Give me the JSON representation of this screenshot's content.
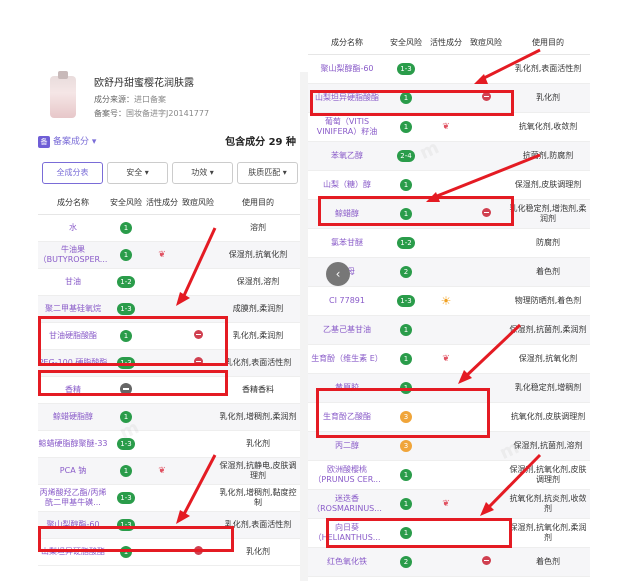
{
  "product": {
    "name": "欧舒丹甜蜜樱花润肤露",
    "source_label": "成分来源：",
    "source_value": "进口备案",
    "record_label": "备案号：",
    "record_value": "国妆备进字J20141777"
  },
  "summary": {
    "badge": "备",
    "section_label": "备案成分",
    "section_caret": "▾",
    "count_text": "包含成分 29 种"
  },
  "filters": {
    "all": "全成分表",
    "safety": "安全 ▾",
    "function": "功效 ▾",
    "skin": "肤质匹配 ▾"
  },
  "headers": {
    "name": "成分名称",
    "risk": "安全风险",
    "active": "活性成分",
    "acne": "致痘风险",
    "use": "使用目的"
  },
  "left_rows": [
    {
      "name": "水",
      "risk": "1",
      "active": "",
      "acne": false,
      "use": "溶剂"
    },
    {
      "name": "牛油果（BUTYROSPER...",
      "risk": "1",
      "active": "❦",
      "acne": false,
      "use": "保湿剂,抗氧化剂"
    },
    {
      "name": "甘油",
      "risk": "1-2",
      "active": "",
      "acne": false,
      "use": "保湿剂,溶剂"
    },
    {
      "name": "聚二甲基硅氧烷",
      "risk": "1-3",
      "active": "",
      "acne": false,
      "use": "成膜剂,柔润剂"
    },
    {
      "name": "甘油硬脂酸酯",
      "risk": "1",
      "active": "",
      "acne": true,
      "use": "乳化剂,柔润剂"
    },
    {
      "name": "PEG-100 硬脂酸酯",
      "risk": "1-3",
      "active": "",
      "acne": true,
      "use": "乳化剂,表面活性剂"
    },
    {
      "name": "香精",
      "risk": "—",
      "active": "",
      "acne": false,
      "use": "香精香料"
    },
    {
      "name": "鲸蜡硬脂醇",
      "risk": "1",
      "active": "",
      "acne": false,
      "use": "乳化剂,增稠剂,柔润剂"
    },
    {
      "name": "鲸蜡硬脂醇聚醚-33",
      "risk": "1-3",
      "active": "",
      "acne": false,
      "use": "乳化剂"
    },
    {
      "name": "PCA 钠",
      "risk": "1",
      "active": "❦",
      "acne": false,
      "use": "保湿剂,抗静电,皮肤调理剂"
    },
    {
      "name": "丙烯酸羟乙酯/丙烯酰二甲基牛磺...",
      "risk": "1-3",
      "active": "",
      "acne": false,
      "use": "乳化剂,增稠剂,黏度控制"
    },
    {
      "name": "聚山梨醇酯-60",
      "risk": "1-3",
      "active": "",
      "acne": false,
      "use": "乳化剂,表面活性剂"
    },
    {
      "name": "山梨坦异硬脂酸酯",
      "risk": "1",
      "active": "",
      "acne": true,
      "use": "乳化剂"
    }
  ],
  "right_rows": [
    {
      "name": "聚山梨醇酯-60",
      "risk": "1-3",
      "active": "",
      "acne": false,
      "use": "乳化剂,表面活性剂"
    },
    {
      "name": "山梨坦异硬脂酸酯",
      "risk": "1",
      "active": "",
      "acne": true,
      "use": "乳化剂"
    },
    {
      "name": "葡萄（VITIS VINIFERA）籽油",
      "risk": "1",
      "active": "❦",
      "acne": false,
      "use": "抗氧化剂,收敛剂"
    },
    {
      "name": "苯氧乙醇",
      "risk": "2-4",
      "active": "",
      "acne": false,
      "use": "抗菌剂,防腐剂"
    },
    {
      "name": "山梨（糖）醇",
      "risk": "1",
      "active": "",
      "acne": false,
      "use": "保湿剂,皮肤调理剂"
    },
    {
      "name": "鲸蜡醇",
      "risk": "1",
      "active": "",
      "acne": true,
      "use": "乳化稳定剂,增泡剂,柔润剂"
    },
    {
      "name": "氯苯甘醚",
      "risk": "1-2",
      "active": "",
      "acne": false,
      "use": "防腐剂"
    },
    {
      "name": "云母",
      "risk": "2",
      "active": "",
      "acne": false,
      "use": "着色剂"
    },
    {
      "name": "CI 77891",
      "risk": "1-3",
      "active": "☀",
      "acne": false,
      "use": "物理防晒剂,着色剂"
    },
    {
      "name": "乙基己基甘油",
      "risk": "1",
      "active": "",
      "acne": false,
      "use": "保湿剂,抗菌剂,柔润剂"
    },
    {
      "name": "生育酚（维生素 E）",
      "risk": "1",
      "active": "❦",
      "acne": false,
      "use": "保湿剂,抗氧化剂"
    },
    {
      "name": "黄原胶",
      "risk": "1",
      "active": "",
      "acne": false,
      "use": "乳化稳定剂,增稠剂"
    },
    {
      "name": "生育酚乙酸酯",
      "risk": "3",
      "active": "",
      "acne": false,
      "use": "抗氧化剂,皮肤调理剂"
    },
    {
      "name": "丙二醇",
      "risk": "3",
      "active": "",
      "acne": false,
      "use": "保湿剂,抗菌剂,溶剂"
    },
    {
      "name": "欧洲酸樱桃（PRUNUS CER...",
      "risk": "1",
      "active": "",
      "acne": false,
      "use": "保湿剂,抗氧化剂,皮肤调理剂"
    },
    {
      "name": "迷迭香（ROSMARINUS...",
      "risk": "1",
      "active": "❦",
      "acne": false,
      "use": "抗氧化剂,抗炎剂,收敛剂"
    },
    {
      "name": "向日葵（HELIANTHUS...",
      "risk": "1",
      "active": "",
      "acne": false,
      "use": "保湿剂,抗氧化剂,柔润剂"
    },
    {
      "name": "红色氧化铁",
      "risk": "2",
      "active": "",
      "acne": true,
      "use": "着色剂"
    }
  ],
  "colors": {
    "accent": "#7a6cd7",
    "risk_green": "#2a9c4a",
    "risk_orange": "#f0a53a",
    "highlight_red": "#e41b23"
  },
  "icons": {
    "back": "chevron-left-icon",
    "acne": "acne-risk-icon",
    "active": "active-ingredient-icon",
    "sun": "sun-icon"
  }
}
